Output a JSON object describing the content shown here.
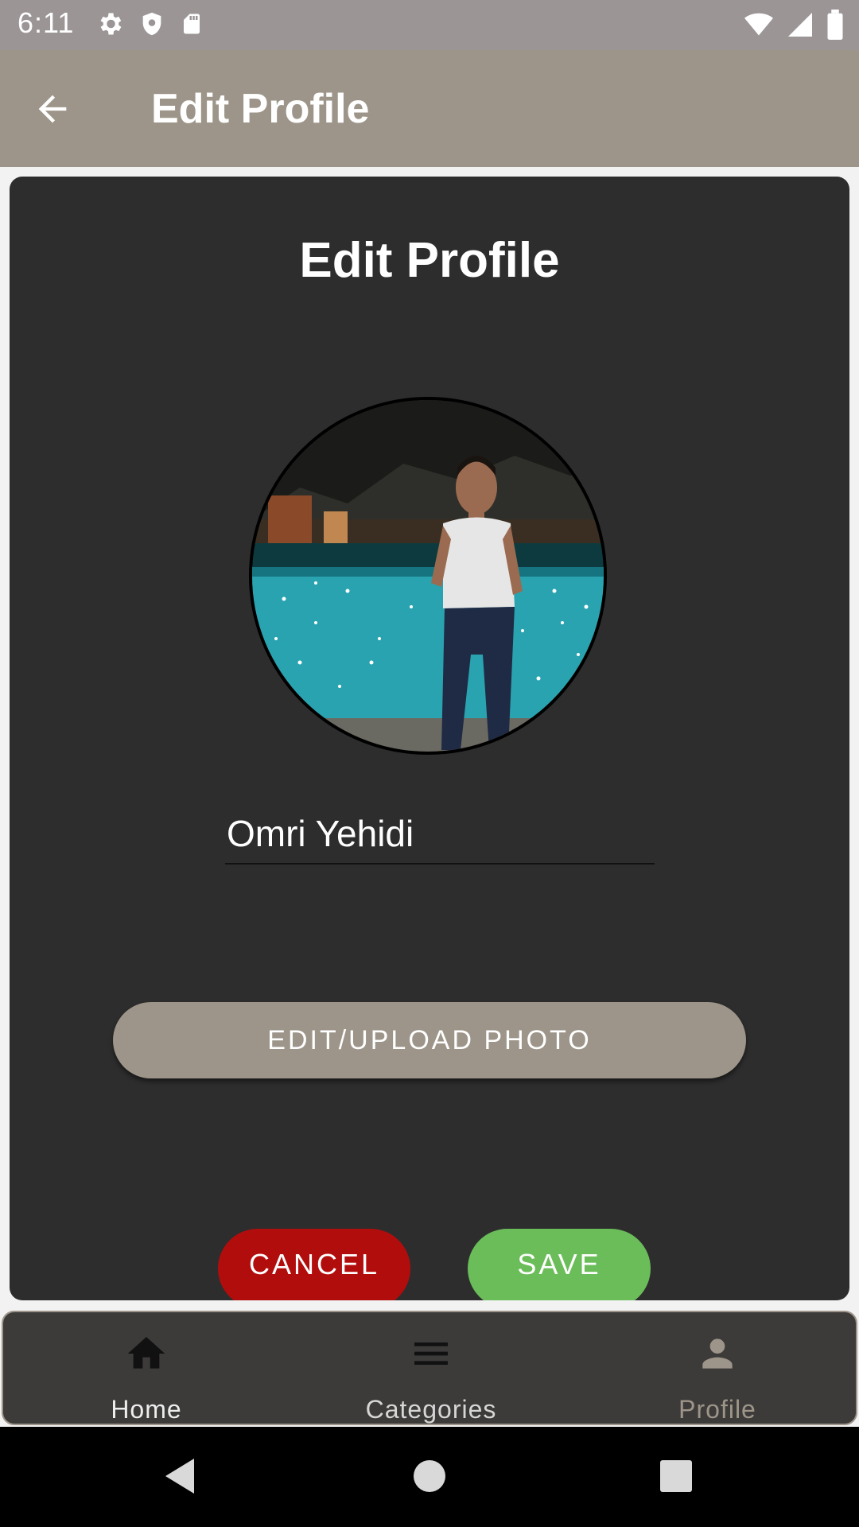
{
  "status_bar": {
    "time": "6:11",
    "icons_left": [
      "gear-icon",
      "shield-icon",
      "sd-card-icon"
    ],
    "icons_right": [
      "wifi-icon",
      "signal-icon",
      "battery-icon"
    ]
  },
  "app_bar": {
    "title": "Edit Profile",
    "back_icon": "arrow-back-icon",
    "background": "#9d9589"
  },
  "card": {
    "title": "Edit Profile",
    "name_value": "Omri Yehidi",
    "upload_label": "EDIT/UPLOAD PHOTO",
    "cancel_label": "CANCEL",
    "save_label": "SAVE",
    "colors": {
      "cancel": "#b20d0d",
      "save": "#6bbd5a",
      "upload": "#9d9589",
      "card": "#2d2d2d"
    }
  },
  "bottom_nav": {
    "items": [
      {
        "label": "Home",
        "icon": "home-icon",
        "active": true
      },
      {
        "label": "Categories",
        "icon": "menu-icon",
        "active": true
      },
      {
        "label": "Profile",
        "icon": "person-icon",
        "active": false
      }
    ]
  },
  "system_nav": {
    "icons": [
      "back-triangle-icon",
      "home-circle-icon",
      "recents-square-icon"
    ]
  }
}
